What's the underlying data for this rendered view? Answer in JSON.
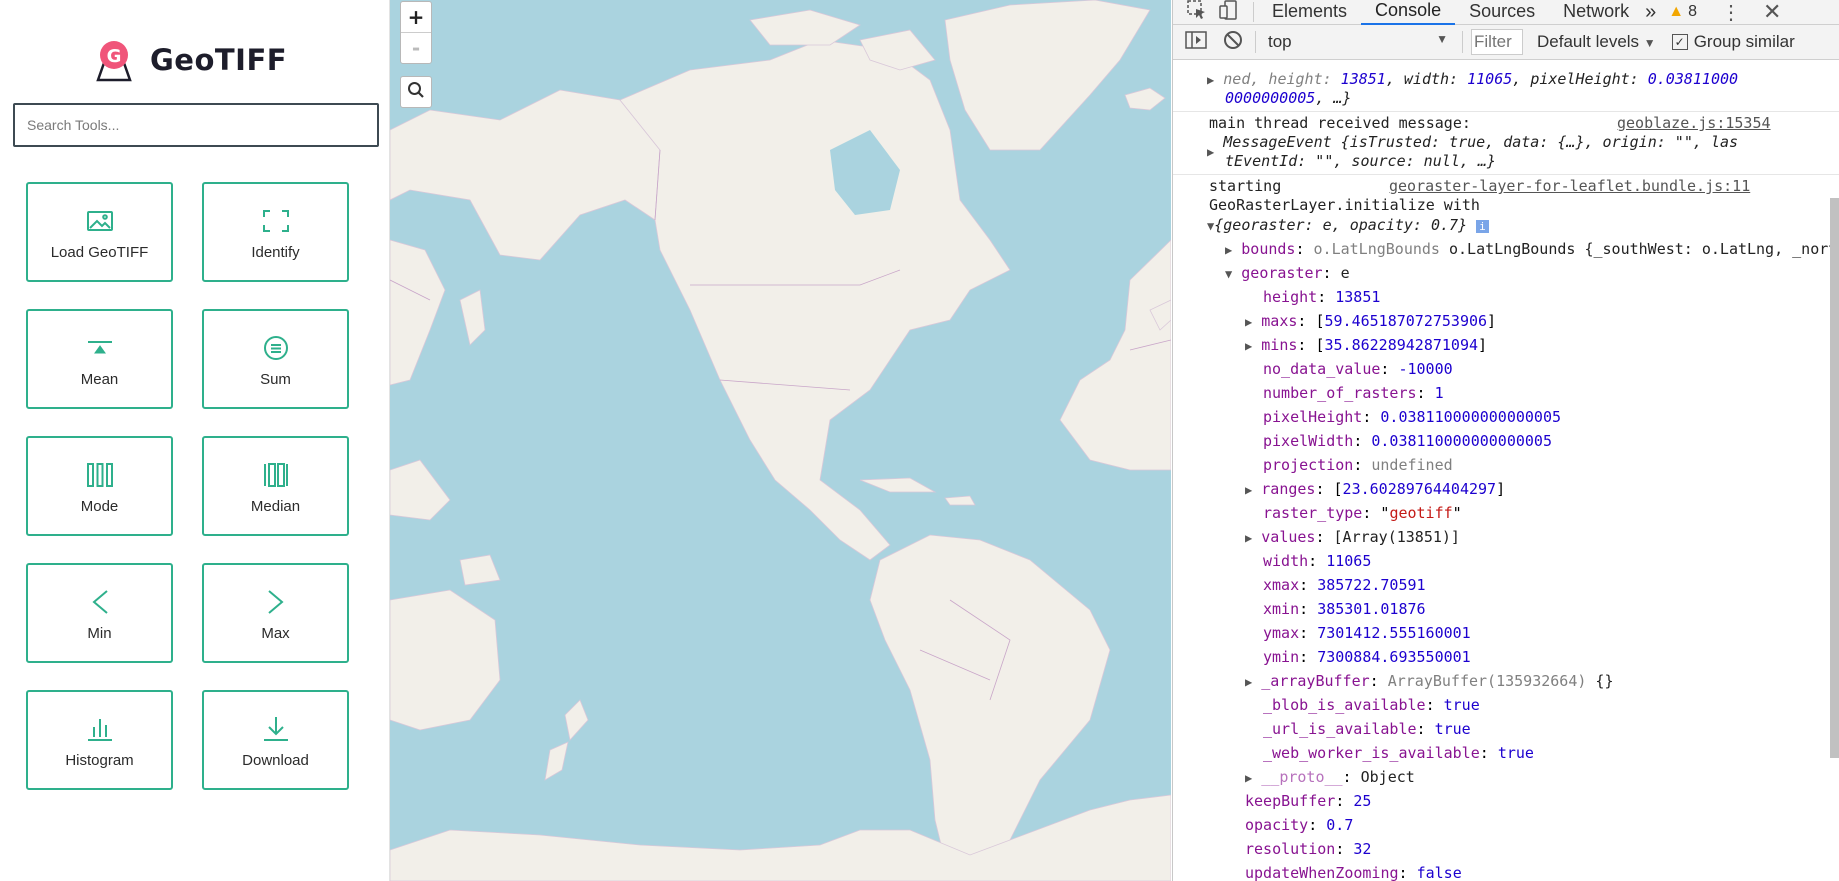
{
  "sidebar": {
    "app_title": "GeoTIFF",
    "search_placeholder": "Search Tools...",
    "tools": [
      {
        "label": "Load GeoTIFF",
        "icon": "image-icon"
      },
      {
        "label": "Identify",
        "icon": "focus-frame-icon"
      },
      {
        "label": "Mean",
        "icon": "mean-icon"
      },
      {
        "label": "Sum",
        "icon": "sum-icon"
      },
      {
        "label": "Mode",
        "icon": "mode-bars-icon"
      },
      {
        "label": "Median",
        "icon": "median-bars-icon"
      },
      {
        "label": "Min",
        "icon": "chevron-left-icon"
      },
      {
        "label": "Max",
        "icon": "chevron-right-icon"
      },
      {
        "label": "Histogram",
        "icon": "histogram-icon"
      },
      {
        "label": "Download",
        "icon": "download-icon"
      }
    ],
    "accent_color": "#2eb08c"
  },
  "map": {
    "zoom_in": "+",
    "zoom_out": "-",
    "water_color": "#aad3df",
    "land_color": "#f2efe9"
  },
  "devtools": {
    "tabs": [
      "Elements",
      "Console",
      "Sources",
      "Network"
    ],
    "active_tab": "Console",
    "more_tabs": "»",
    "warning_count": "8",
    "context": "top",
    "filter_placeholder": "Filter",
    "levels": "Default levels",
    "group_label": "Group similar",
    "console": {
      "line1a": "ned, height: ",
      "line1_height": "13851",
      "line1b": ", width: ",
      "line1_width": "11065",
      "line1c": ", pixelHeight: ",
      "line1_ph": "0.03811000",
      "line2": "0000000005",
      "line2b": ", …}",
      "msg1_text": "main thread received message:",
      "msg1_link": "geoblaze.js:15354",
      "msg1_obj": "MessageEvent {isTrusted: true, data: {…}, origin: \"\", las",
      "msg1_obj2": "tEventId: \"\", source: null, …}",
      "msg2_text": "starting",
      "msg2_link": "georaster-layer-for-leaflet.bundle.js:11",
      "msg2_text2": "GeoRasterLayer.initialize with",
      "obj_head": "{georaster: e, opacity: 0.7}",
      "props": [
        {
          "key": "bounds",
          "val": "o.LatLngBounds {_southWest: o.LatLng, _northEast: o"
        },
        {
          "key": "georaster",
          "val": "e"
        },
        {
          "key": "height",
          "val": "13851"
        },
        {
          "key": "maxs",
          "val": "[59.465187072753906]"
        },
        {
          "key": "mins",
          "val": "[35.86228942871094]"
        },
        {
          "key": "no_data_value",
          "val": "-10000"
        },
        {
          "key": "number_of_rasters",
          "val": "1"
        },
        {
          "key": "pixelHeight",
          "val": "0.038110000000000005"
        },
        {
          "key": "pixelWidth",
          "val": "0.038110000000000005"
        },
        {
          "key": "projection",
          "val": "undefined"
        },
        {
          "key": "ranges",
          "val": "[23.60289764404297]"
        },
        {
          "key": "raster_type",
          "val": "\"geotiff\""
        },
        {
          "key": "values",
          "val": "[Array(13851)]"
        },
        {
          "key": "width",
          "val": "11065"
        },
        {
          "key": "xmax",
          "val": "385722.70591"
        },
        {
          "key": "xmin",
          "val": "385301.01876"
        },
        {
          "key": "ymax",
          "val": "7301412.555160001"
        },
        {
          "key": "ymin",
          "val": "7300884.693550001"
        },
        {
          "key": "_arrayBuffer",
          "val": "ArrayBuffer(135932664) {}"
        },
        {
          "key": "_blob_is_available",
          "val": "true"
        },
        {
          "key": "_url_is_available",
          "val": "true"
        },
        {
          "key": "_web_worker_is_available",
          "val": "true"
        },
        {
          "key": "__proto__",
          "val": "Object"
        },
        {
          "key": "keepBuffer",
          "val": "25"
        },
        {
          "key": "opacity",
          "val": "0.7"
        },
        {
          "key": "resolution",
          "val": "32"
        },
        {
          "key": "updateWhenZooming",
          "val": "false"
        }
      ]
    }
  }
}
